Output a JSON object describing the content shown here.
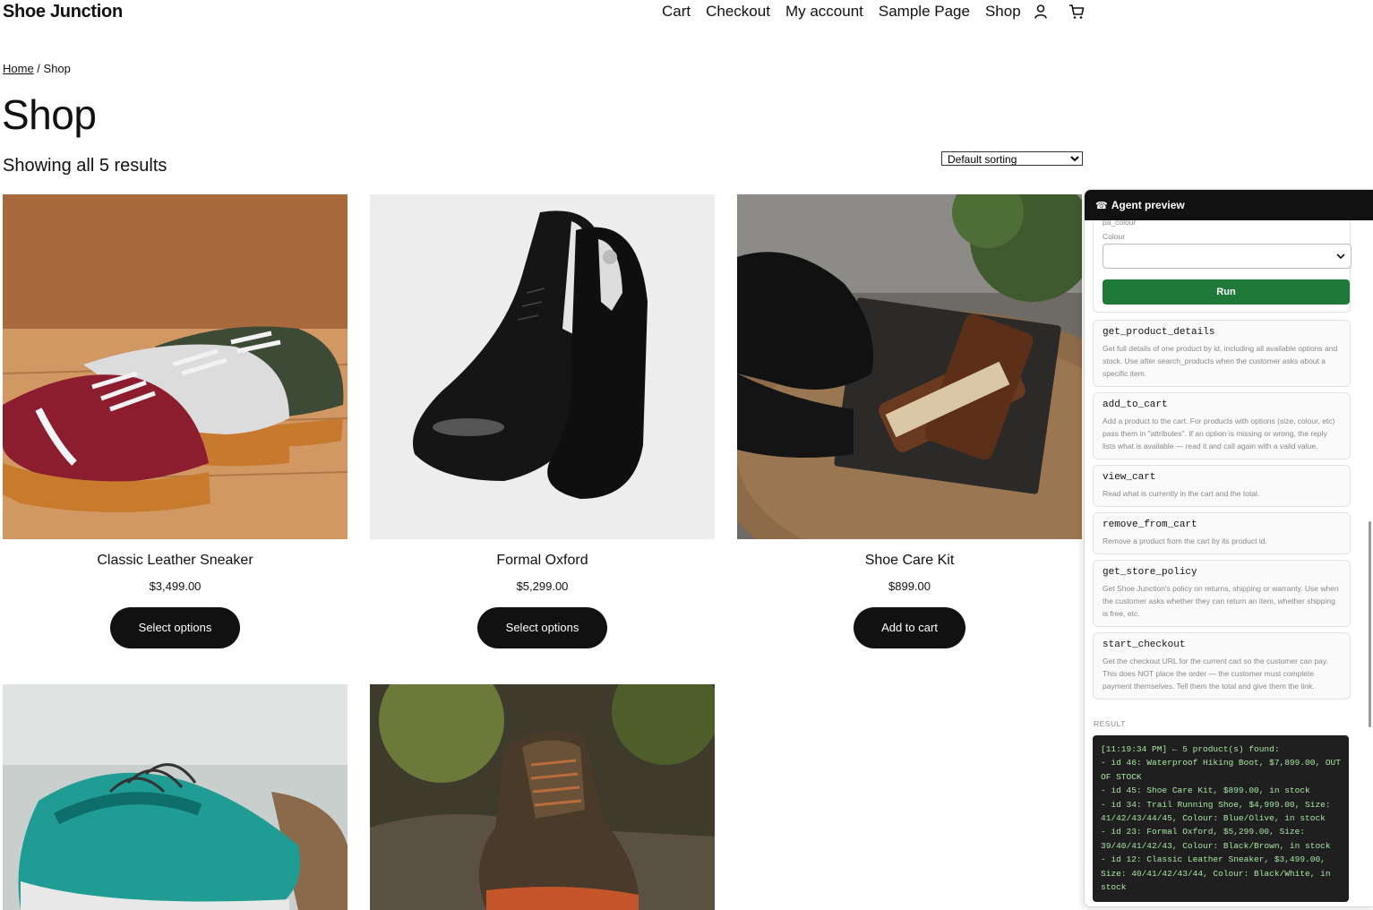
{
  "site": {
    "title": "Shoe Junction"
  },
  "nav": {
    "items": [
      "Cart",
      "Checkout",
      "My account",
      "Sample Page",
      "Shop"
    ]
  },
  "breadcrumb": {
    "home": "Home",
    "current": "Shop"
  },
  "page": {
    "title": "Shop",
    "result_count": "Showing all 5 results",
    "sort_selected": "Default sorting"
  },
  "products": [
    {
      "name": "Classic Leather Sneaker",
      "price": "$3,499.00",
      "button": "Select options"
    },
    {
      "name": "Formal Oxford",
      "price": "$5,299.00",
      "button": "Select options"
    },
    {
      "name": "Shoe Care Kit",
      "price": "$899.00",
      "button": "Add to cart"
    },
    {
      "name": "Trail Running Shoe"
    },
    {
      "name": "Waterproof Hiking Boot"
    }
  ],
  "agent": {
    "title": "Agent preview",
    "form": {
      "attr_key": "pa_colour",
      "attr_label": "Colour",
      "run_label": "Run"
    },
    "tools": [
      {
        "name": "get_product_details",
        "desc": "Get full details of one product by id, including all available options and stock. Use after search_products when the customer asks about a specific item."
      },
      {
        "name": "add_to_cart",
        "desc": "Add a product to the cart. For products with options (size, colour, etc) pass them in \"attributes\". If an option is missing or wrong, the reply lists what is available — read it and call again with a valid value."
      },
      {
        "name": "view_cart",
        "desc": "Read what is currently in the cart and the total."
      },
      {
        "name": "remove_from_cart",
        "desc": "Remove a product from the cart by its product id."
      },
      {
        "name": "get_store_policy",
        "desc": "Get Shoe Junction's policy on returns, shipping or warranty. Use when the customer asks whether they can return an item, whether shipping is free, etc."
      },
      {
        "name": "start_checkout",
        "desc": "Get the checkout URL for the current cart so the customer can pay. This does NOT place the order — the customer must complete payment themselves. Tell them the total and give them the link."
      }
    ],
    "result_label": "RESULT",
    "result_text": "[11:19:34 PM] ← 5 product(s) found:\n- id 46: Waterproof Hiking Boot, $7,899.00, OUT OF STOCK\n- id 45: Shoe Care Kit, $899.00, in stock\n- id 34: Trail Running Shoe, $4,999.00, Size: 41/42/43/44/45, Colour: Blue/Olive, in stock\n- id 23: Formal Oxford, $5,299.00, Size: 39/40/41/42/43, Colour: Black/Brown, in stock\n- id 12: Classic Leather Sneaker, $3,499.00, Size: 40/41/42/43/44, Colour: Black/White, in stock"
  }
}
